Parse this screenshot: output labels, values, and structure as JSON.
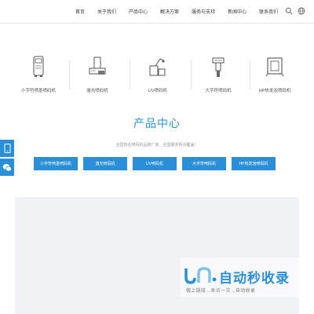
{
  "nav": {
    "items": [
      {
        "label": "首页"
      },
      {
        "label": "关于我们"
      },
      {
        "label": "产品中心"
      },
      {
        "label": "解决方案"
      },
      {
        "label": "服务与支持"
      },
      {
        "label": "新闻中心"
      },
      {
        "label": "联系我们"
      }
    ],
    "icons": [
      "search-icon",
      "globe-icon"
    ]
  },
  "categories": [
    {
      "label": "小字符喷墨喷码机",
      "icon": "inkjet-printer-icon"
    },
    {
      "label": "激光喷码机",
      "icon": "laser-printer-icon"
    },
    {
      "label": "UV喷码机",
      "icon": "uv-printer-icon"
    },
    {
      "label": "大字符喷码机",
      "icon": "large-character-printer-icon"
    },
    {
      "label": "HP热发泡喷码机",
      "icon": "hp-thermal-printer-icon"
    }
  ],
  "section": {
    "title": "产品中心",
    "subtitle": "全国知名喷码机品牌厂家，全国服务网点覆盖！"
  },
  "buttons": [
    {
      "label": "小字符喷墨喷码机"
    },
    {
      "label": "激光喷码机"
    },
    {
      "label": "UV喷码机"
    },
    {
      "label": "大字符喷码机"
    },
    {
      "label": "HP热发泡喷码机"
    }
  ],
  "side_buttons": [
    "phone-icon",
    "wechat-icon"
  ],
  "watermark": {
    "title": "自动秒收录",
    "subtitle": "做上链接→来访一次→自动收录"
  },
  "colors": {
    "accent": "#2a8fd6",
    "panel": "#f1f2f5",
    "text": "#333333"
  }
}
